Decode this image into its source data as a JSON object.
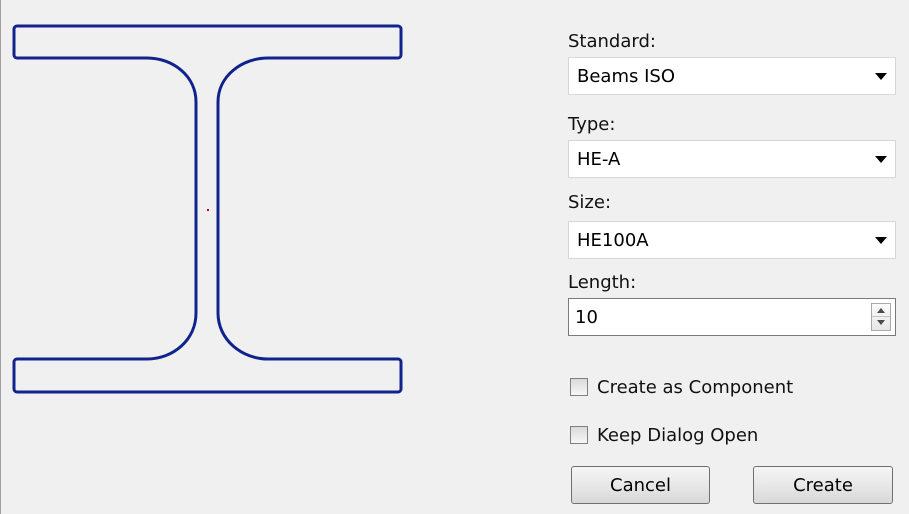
{
  "form": {
    "standard_label": "Standard:",
    "standard_value": "Beams ISO",
    "type_label": "Type:",
    "type_value": "HE-A",
    "size_label": "Size:",
    "size_value": "HE100A",
    "length_label": "Length:",
    "length_value": "10",
    "create_component_label": "Create as Component",
    "create_component_checked": false,
    "keep_open_label": "Keep Dialog Open",
    "keep_open_checked": false
  },
  "buttons": {
    "cancel": "Cancel",
    "create": "Create"
  },
  "icons": {
    "dropdown": "chevron-down-icon",
    "spin_up": "spin-up-icon",
    "spin_down": "spin-down-icon"
  },
  "colors": {
    "profile_outline": "#0f238c",
    "center_mark": "#c00000",
    "background": "#f0f0f0"
  }
}
